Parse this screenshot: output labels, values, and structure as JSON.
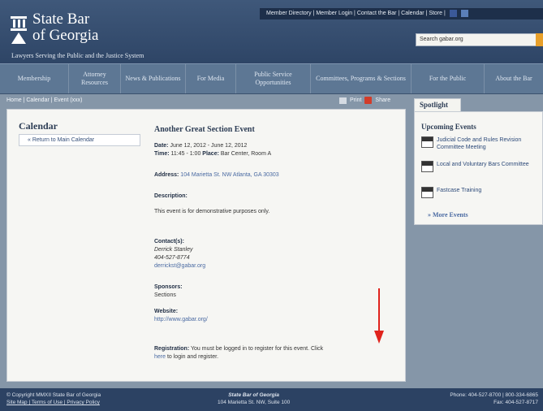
{
  "header": {
    "brand_line1": "State Bar",
    "brand_line2": "of Georgia",
    "tagline": "Lawyers Serving the Public and the Justice System",
    "search_placeholder": "Search gabar.org",
    "top_links": [
      "Member Directory",
      "Member Login",
      "Contact the Bar",
      "Calendar",
      "Store"
    ]
  },
  "nav": {
    "items": [
      {
        "label": "Membership"
      },
      {
        "label": "Attorney Resources"
      },
      {
        "label": "News & Publications"
      },
      {
        "label": "For Media"
      },
      {
        "label": "Public Service Opportunities"
      },
      {
        "label": "Committees, Programs & Sections"
      },
      {
        "label": "For the Public"
      },
      {
        "label": "About the Bar"
      }
    ]
  },
  "breadcrumb": "Home | Calendar | Event (xxx)",
  "tools": {
    "print": "Print",
    "share": "Share"
  },
  "calendar": {
    "title": "Calendar",
    "back_link": "« Return to Main Calendar"
  },
  "event": {
    "title": "Another Great Section Event",
    "date_label": "Date:",
    "date_value": "June 12, 2012 - June 12, 2012",
    "time_label": "Time:",
    "time_value": "11:45 - 1:00",
    "place_label": "Place:",
    "place_value": "Bar Center, Room A",
    "address_label": "Address:",
    "address_value": "104 Marietta St. NW Atlanta, GA 30303",
    "description_label": "Description:",
    "description_value": "This event is for demonstrative purposes only.",
    "contact_label": "Contact(s):",
    "contact_name": "Derrick Stanley",
    "contact_phone": "404-527-8774",
    "contact_email": "derrickst@gabar.org",
    "sponsors_label": "Sponsors:",
    "sponsors_value": "Sections",
    "website_label": "Website:",
    "website_value": "http://www.gabar.org/",
    "registration_label": "Registration:",
    "registration_value": "You must be logged in to register for this event. Click",
    "registration_link": "here",
    "registration_tail": "to login and register."
  },
  "spotlight": {
    "tab": "Spotlight",
    "heading": "Upcoming Events",
    "items": [
      "Judicial Code and Rules Revision Committee Meeting",
      "Local and Voluntary Bars Committee",
      "Fastcase Training"
    ],
    "more": "» More Events"
  },
  "footer": {
    "copyright": "© Copyright MMXII State Bar of Georgia",
    "links": "Site Map | Terms of Use | Privacy Policy",
    "org": "State Bar of Georgia",
    "address": "104 Marietta St. NW, Suite 100",
    "phone": "Phone: 404-527-8700 | 800-334-6865",
    "fax": "Fax: 404-527-8717"
  },
  "colors": {
    "header": "#2e4566",
    "nav": "#5d7794",
    "panel": "#f6f6f3",
    "accent_arrow": "#e0231c"
  }
}
